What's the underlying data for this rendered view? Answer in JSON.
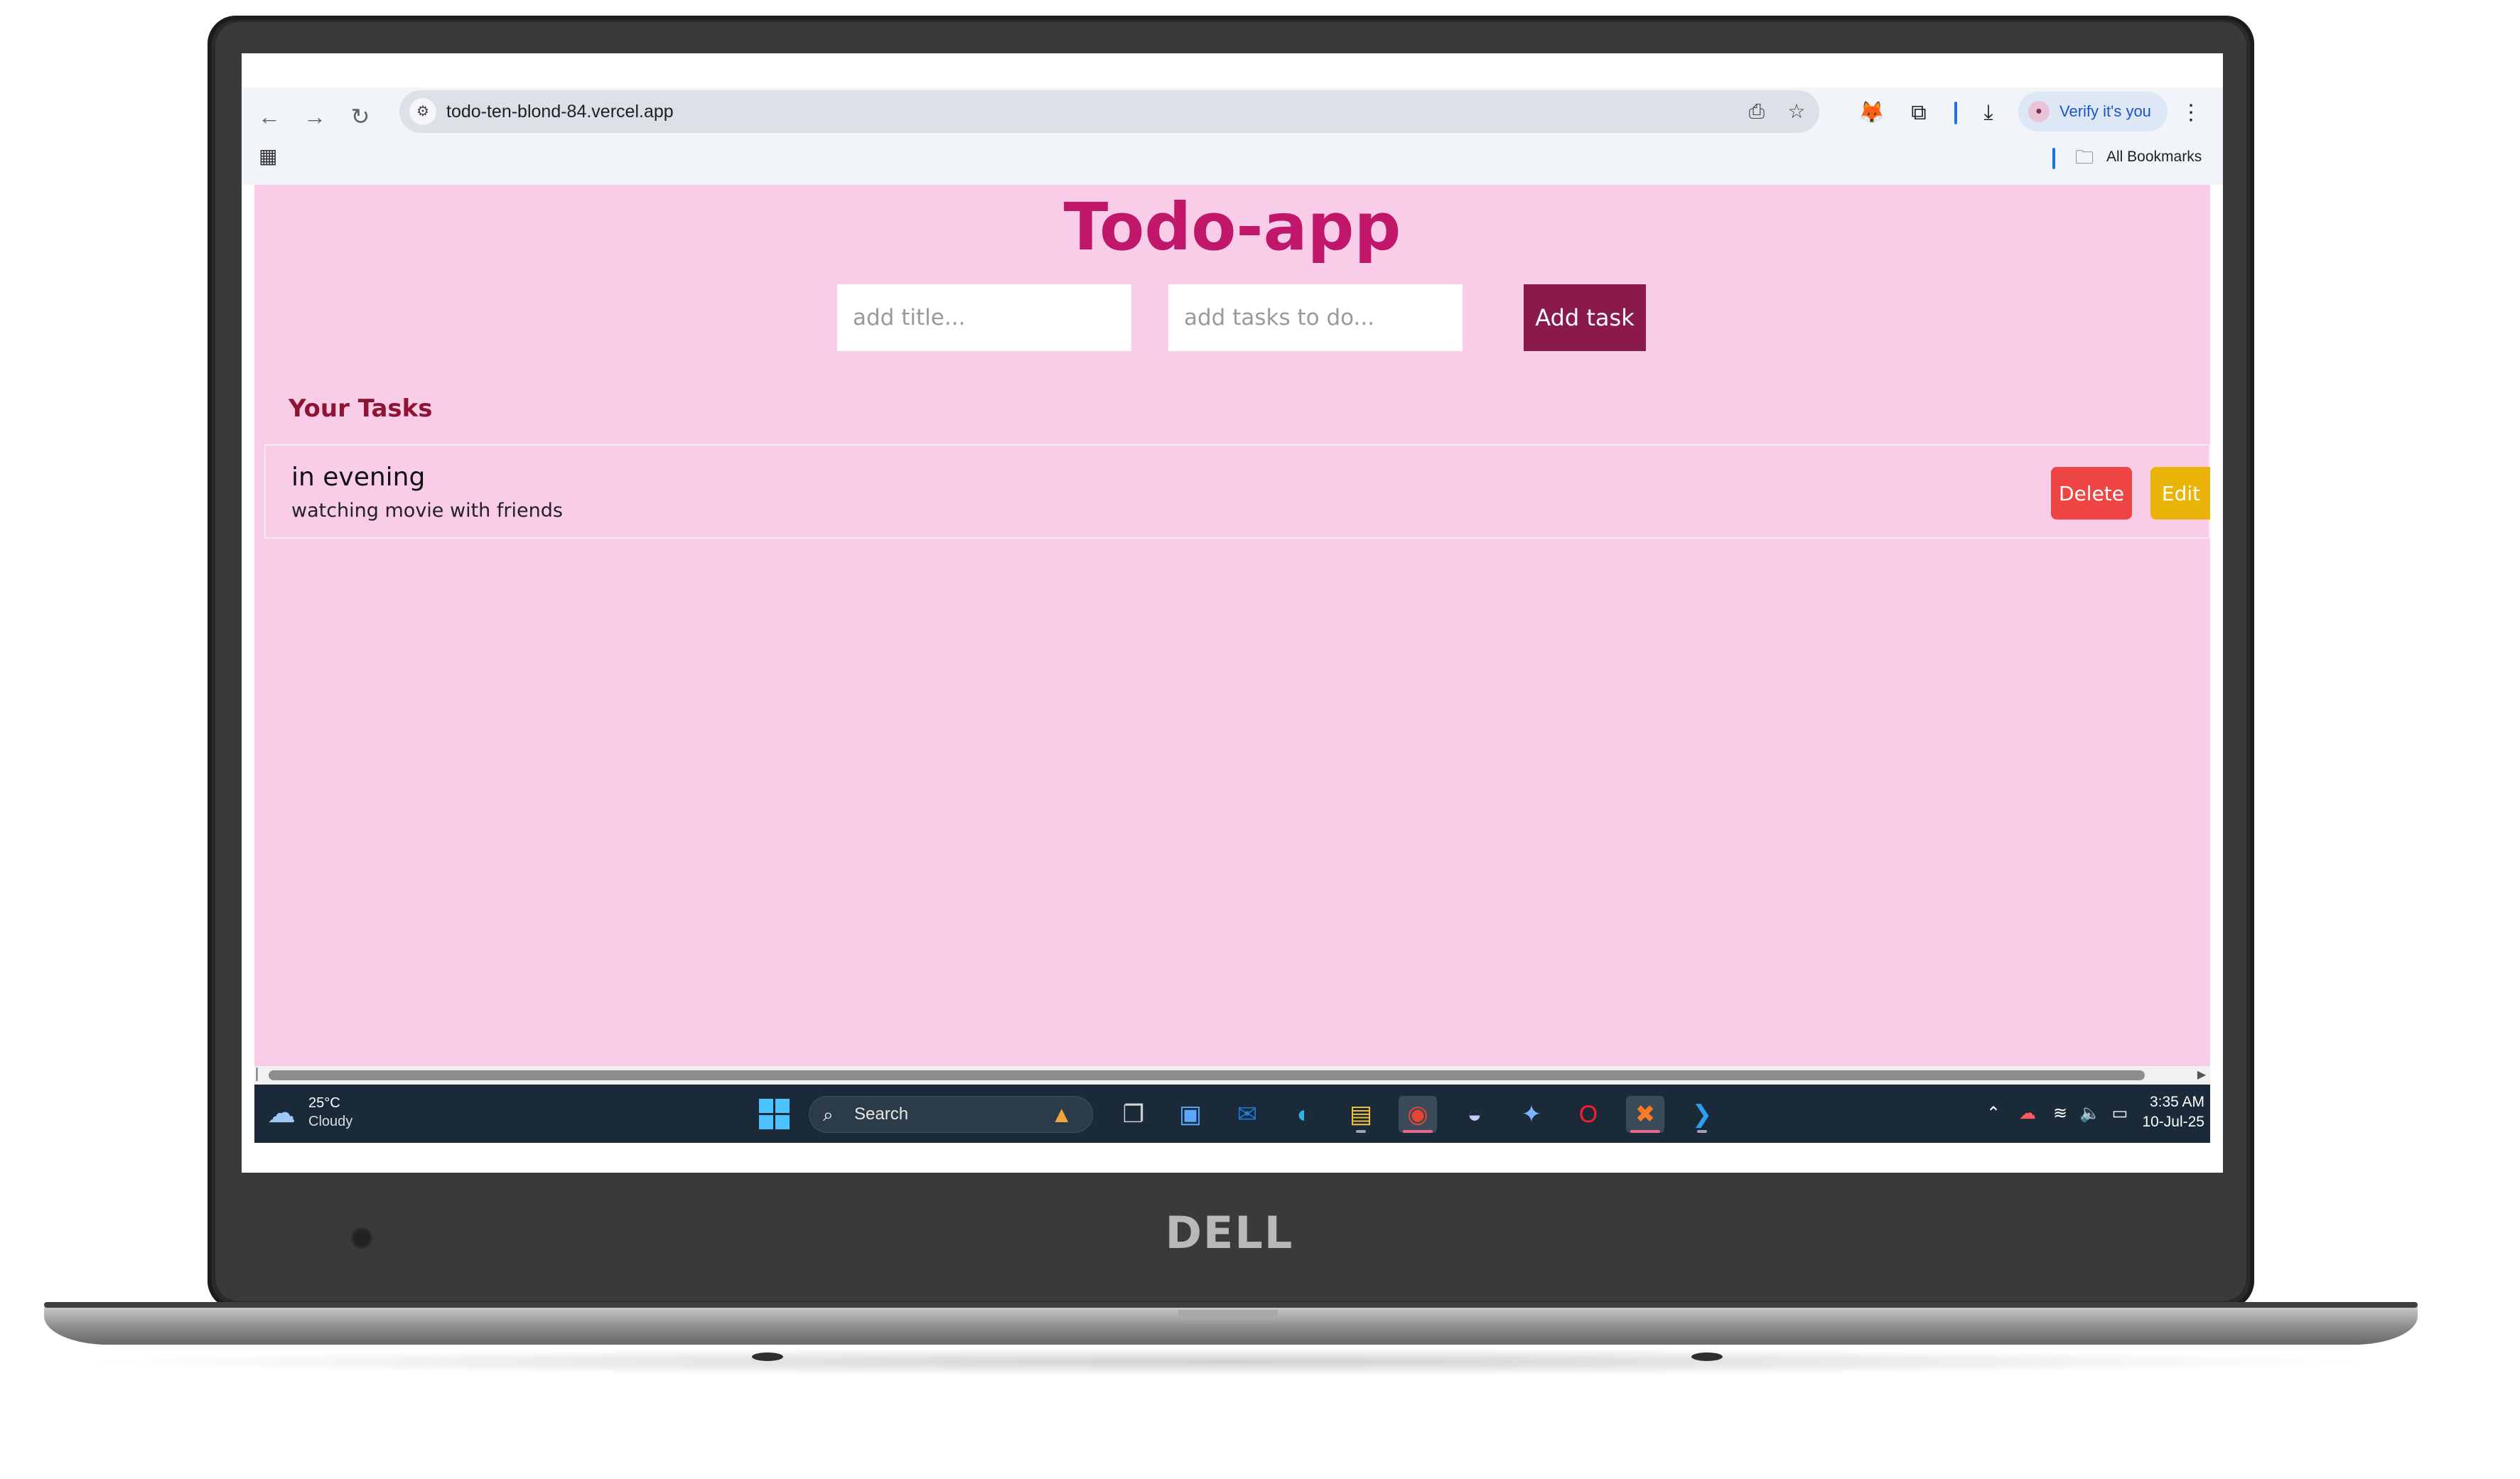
{
  "browser": {
    "url": "todo-ten-blond-84.vercel.app",
    "profile_label": "Verify it's you",
    "bookmarks_label": "All Bookmarks"
  },
  "app": {
    "title": "Todo-app",
    "title_input_placeholder": "add title...",
    "task_input_placeholder": "add tasks to do...",
    "add_button_label": "Add task",
    "section_title": "Your Tasks",
    "tasks": [
      {
        "title": "in evening",
        "description": "watching movie with friends",
        "delete_label": "Delete",
        "edit_label": "Edit"
      }
    ]
  },
  "taskbar": {
    "weather_temp": "25°C",
    "weather_desc": "Cloudy",
    "search_label": "Search",
    "clock_time": "3:35 AM",
    "clock_date": "10-Jul-25"
  },
  "laptop": {
    "brand": "DELL"
  },
  "colors": {
    "page_background": "#f9cde8",
    "title_color": "#c0176b",
    "add_button": "#8a1a4b",
    "section_title": "#8f1433",
    "delete_button": "#ef4444",
    "edit_button": "#eab308",
    "taskbar": "#1b2a38"
  },
  "icons": {
    "back": "back-arrow-icon",
    "forward": "forward-arrow-icon",
    "reload": "reload-icon",
    "site_info": "site-info-icon",
    "install": "install-app-icon",
    "bookmark": "star-icon",
    "extension_fox": "metamask-icon",
    "extensions": "puzzle-icon",
    "download": "download-icon",
    "menu": "kebab-menu-icon",
    "apps": "apps-grid-icon",
    "folder": "folder-icon"
  }
}
